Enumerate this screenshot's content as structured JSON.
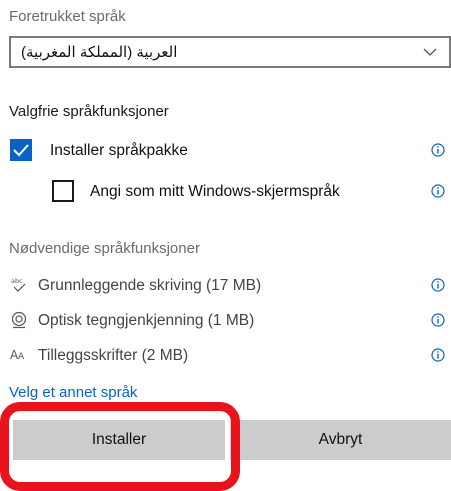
{
  "preferred_language": {
    "label": "Foretrukket språk",
    "selected": "العربية (المملكة المغربية)"
  },
  "optional_features": {
    "heading": "Valgfrie språkfunksjoner",
    "items": [
      {
        "label": "Installer språkpakke",
        "checked": true
      },
      {
        "label": "Angi som mitt Windows-skjermspråk",
        "checked": false
      }
    ]
  },
  "required_features": {
    "heading": "Nødvendige språkfunksjoner",
    "items": [
      {
        "label": "Grunnleggende skriving (17 MB)",
        "icon": "basic-typing-icon"
      },
      {
        "label": "Optisk tegngjenkjenning (1 MB)",
        "icon": "ocr-icon"
      },
      {
        "label": "Tilleggsskrifter (2 MB)",
        "icon": "font-icon"
      }
    ]
  },
  "choose_another_link": "Velg et annet språk",
  "buttons": {
    "install": "Installer",
    "cancel": "Avbryt"
  },
  "colors": {
    "accent": "#0a63c4",
    "highlight": "#e8141b",
    "button_bg": "#cccccc"
  }
}
